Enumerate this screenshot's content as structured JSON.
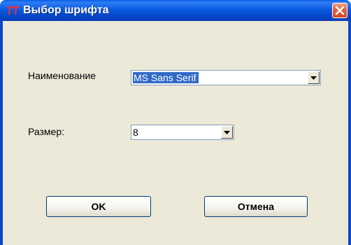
{
  "window": {
    "title": "Выбор шрифта"
  },
  "form": {
    "name_label": "Наименование",
    "name_value": "MS Sans Serif",
    "size_label": "Размер:",
    "size_value": "8"
  },
  "buttons": {
    "ok_label": "OK",
    "cancel_label": "Отмена"
  },
  "icons": {
    "app": "font-app-icon",
    "close": "close-icon",
    "dropdown": "chevron-down-icon"
  },
  "colors": {
    "titlebar": "#0a5fe6",
    "close_button": "#e3603c",
    "dialog_face": "#ece9d8",
    "selection": "#316ac5"
  }
}
